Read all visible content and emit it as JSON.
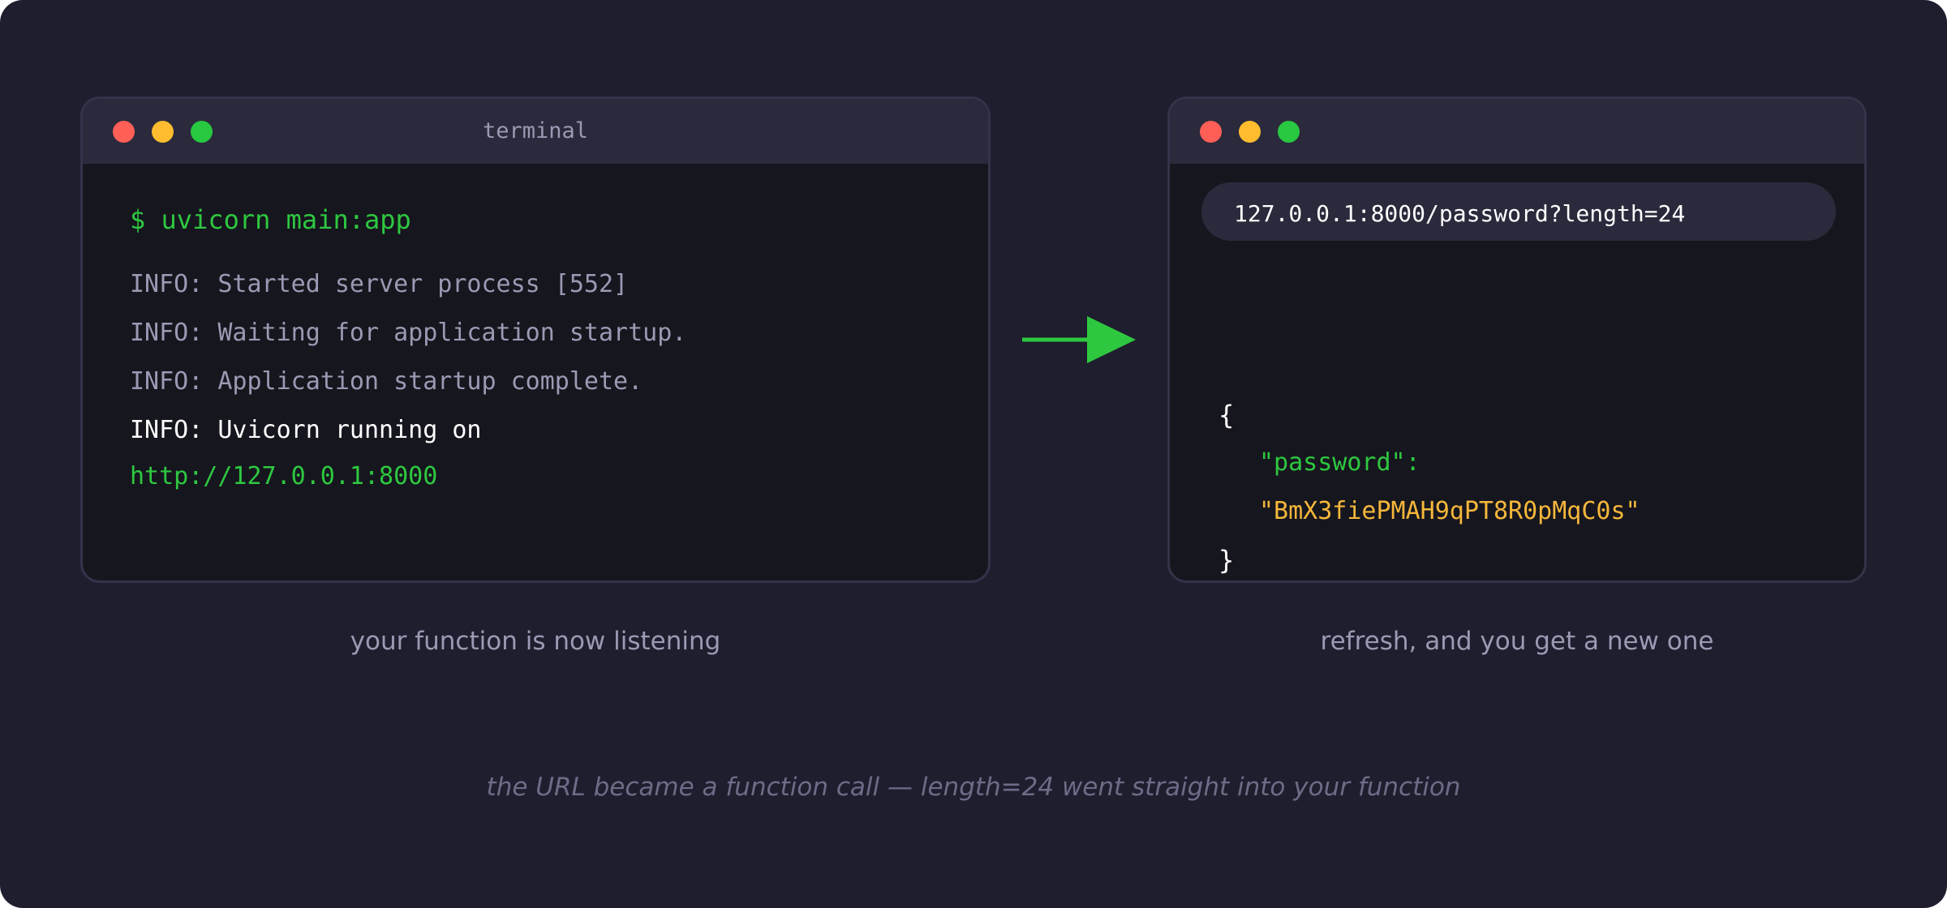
{
  "colors": {
    "background": "#1e1e2e",
    "window": "#16161e",
    "titlebar": "#2a2a3c",
    "accent_green": "#2ec840",
    "accent_yellow": "#f5b73b",
    "muted": "#9a9ab4",
    "footnote": "#6c6c88"
  },
  "terminal": {
    "title": "terminal",
    "command": "$ uvicorn main:app",
    "log_lines": [
      "INFO: Started server process [552]",
      "INFO: Waiting for application startup.",
      "INFO: Application startup complete.",
      "INFO: Uvicorn running on"
    ],
    "url": "http://127.0.0.1:8000"
  },
  "browser": {
    "address": "127.0.0.1:8000/password?length=24",
    "open_brace": "{",
    "key": "\"password\":",
    "value": "\"BmX3fiePMAH9qPT8R0pMqC0s\"",
    "close_brace": "}"
  },
  "icons": {
    "window_controls": [
      "close-dot-icon",
      "minimize-dot-icon",
      "maximize-dot-icon"
    ],
    "connector": "arrow-right-icon"
  },
  "captions": {
    "left": "your function is now listening",
    "right": "refresh, and you get a new one"
  },
  "footnote": "the URL became a function call — length=24 went straight into your function"
}
